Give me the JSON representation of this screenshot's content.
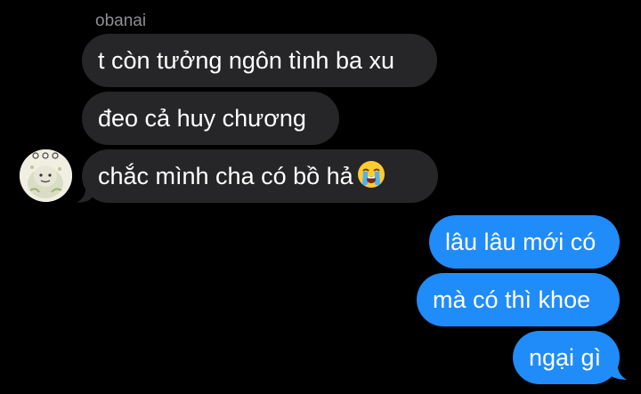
{
  "sender": {
    "name": "obanai"
  },
  "incoming": [
    {
      "text": "t còn tưởng ngôn tình ba xu"
    },
    {
      "text": "đeo cả huy chương"
    },
    {
      "text": "chắc mình cha có bồ hả",
      "emoji": "loudly-crying-face-emoji"
    }
  ],
  "outgoing": [
    {
      "text": "lâu lâu mới có"
    },
    {
      "text": "mà có thì khoe"
    },
    {
      "text": "ngại gì"
    }
  ],
  "colors": {
    "background": "#000000",
    "incoming_bubble": "#262628",
    "outgoing_bubble": "#1f8cf9",
    "sender_name": "#8e8e93"
  }
}
